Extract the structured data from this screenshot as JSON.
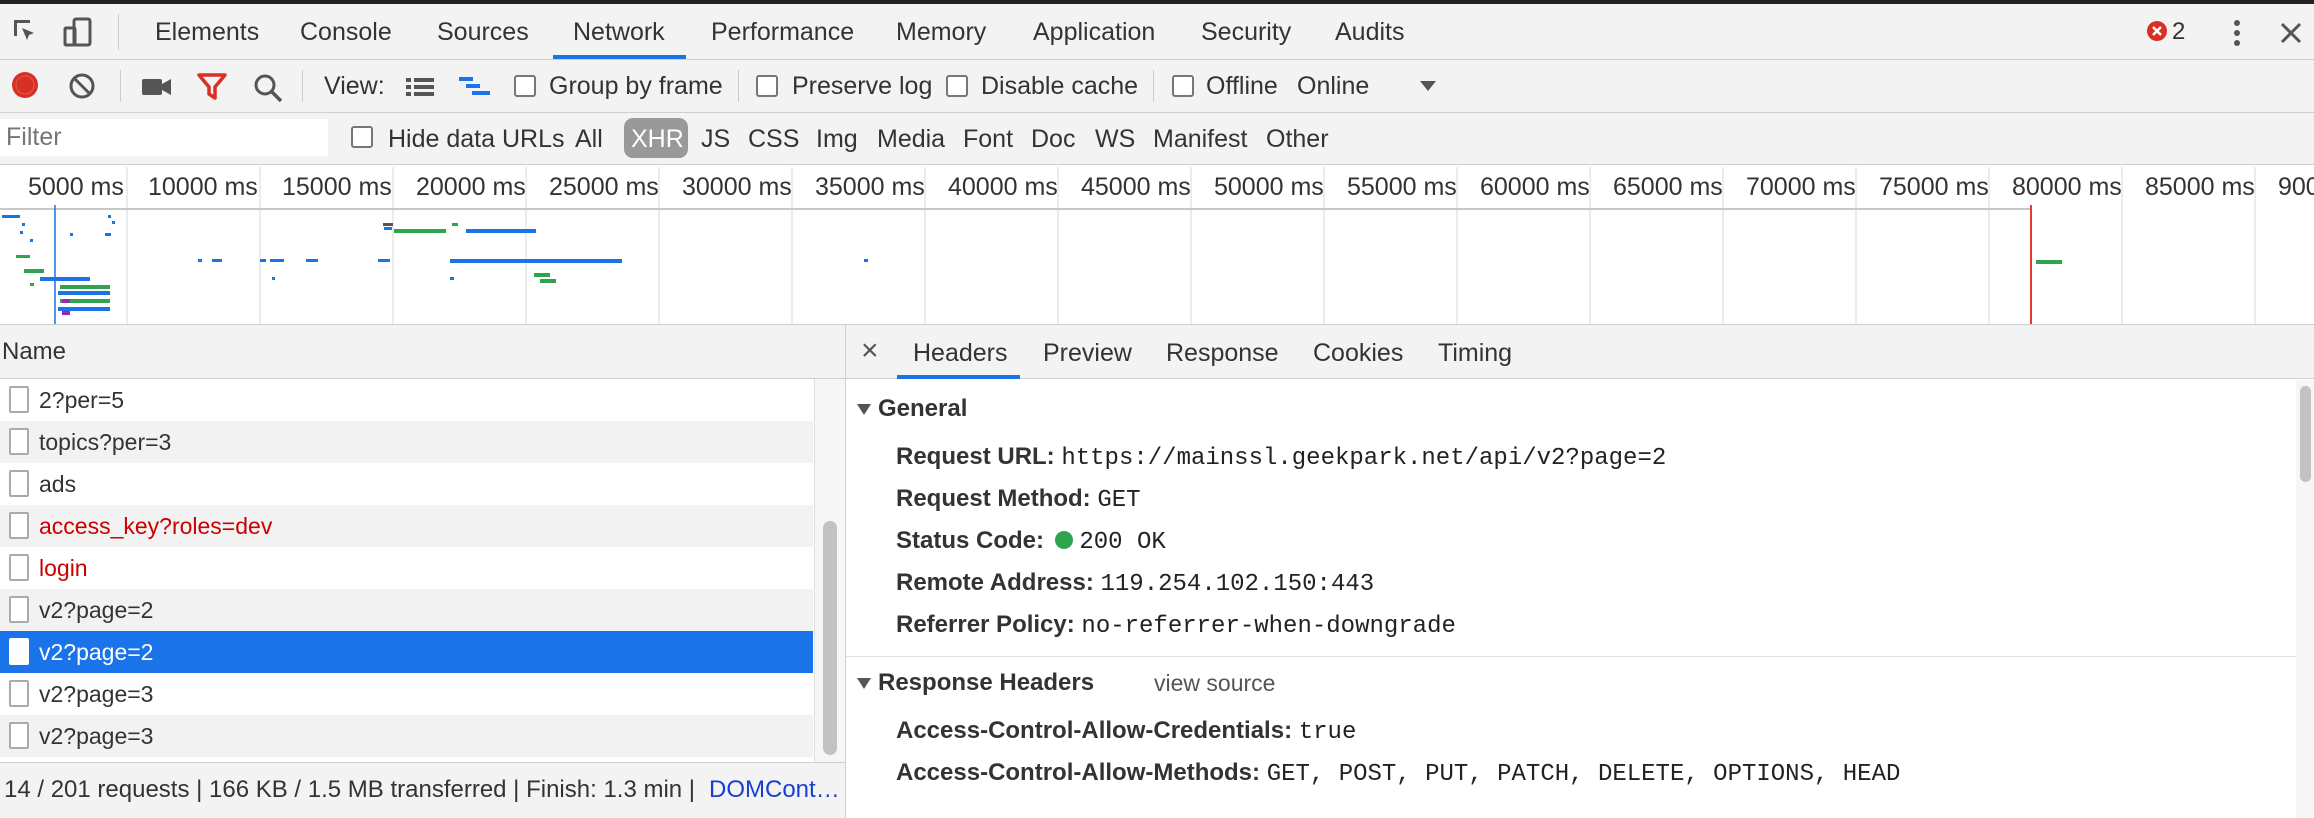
{
  "main_tabs": [
    "Elements",
    "Console",
    "Sources",
    "Network",
    "Performance",
    "Memory",
    "Application",
    "Security",
    "Audits"
  ],
  "active_tab": "Network",
  "error_count": "2",
  "toolbar": {
    "view_label": "View:",
    "group_by_frame": "Group by frame",
    "preserve_log": "Preserve log",
    "disable_cache": "Disable cache",
    "offline": "Offline",
    "throttling": "Online"
  },
  "filter": {
    "placeholder": "Filter",
    "hide_data_urls": "Hide data URLs",
    "types": [
      "All",
      "XHR",
      "JS",
      "CSS",
      "Img",
      "Media",
      "Font",
      "Doc",
      "WS",
      "Manifest",
      "Other"
    ],
    "active_type": "XHR"
  },
  "timeline_ticks": [
    "5000 ms",
    "10000 ms",
    "15000 ms",
    "20000 ms",
    "25000 ms",
    "30000 ms",
    "35000 ms",
    "40000 ms",
    "45000 ms",
    "50000 ms",
    "55000 ms",
    "60000 ms",
    "65000 ms",
    "70000 ms",
    "75000 ms",
    "80000 ms",
    "85000 ms",
    "900"
  ],
  "requests": {
    "header": "Name",
    "rows": [
      {
        "name": "2?per=5",
        "status": "ok"
      },
      {
        "name": "topics?per=3",
        "status": "ok"
      },
      {
        "name": "ads",
        "status": "ok"
      },
      {
        "name": "access_key?roles=dev",
        "status": "error"
      },
      {
        "name": "login",
        "status": "error"
      },
      {
        "name": "v2?page=2",
        "status": "ok"
      },
      {
        "name": "v2?page=2",
        "status": "selected"
      },
      {
        "name": "v2?page=3",
        "status": "ok"
      },
      {
        "name": "v2?page=3",
        "status": "ok"
      }
    ]
  },
  "status_bar": {
    "summary": "14 / 201 requests | 166 KB / 1.5 MB transferred | Finish: 1.3 min | ",
    "link": "DOMCont…"
  },
  "details": {
    "close": "×",
    "tabs": [
      "Headers",
      "Preview",
      "Response",
      "Cookies",
      "Timing"
    ],
    "active_tab": "Headers",
    "general": {
      "title": "General",
      "request_url_key": "Request URL:",
      "request_url": "https://mainssl.geekpark.net/api/v2?page=2",
      "request_method_key": "Request Method:",
      "request_method": "GET",
      "status_code_key": "Status Code:",
      "status_code": "200 OK",
      "remote_address_key": "Remote Address:",
      "remote_address": "119.254.102.150:443",
      "referrer_policy_key": "Referrer Policy:",
      "referrer_policy": "no-referrer-when-downgrade"
    },
    "response_headers": {
      "title": "Response Headers",
      "view_source": "view source",
      "items": [
        {
          "key": "Access-Control-Allow-Credentials:",
          "value": "true"
        },
        {
          "key": "Access-Control-Allow-Methods:",
          "value": "GET, POST, PUT, PATCH, DELETE, OPTIONS, HEAD"
        }
      ]
    }
  },
  "colors": {
    "accent": "#1a73e8",
    "error": "#cc0000",
    "selected": "#1a73e8",
    "record": "#d93025",
    "status_ok": "#2ea44f"
  }
}
